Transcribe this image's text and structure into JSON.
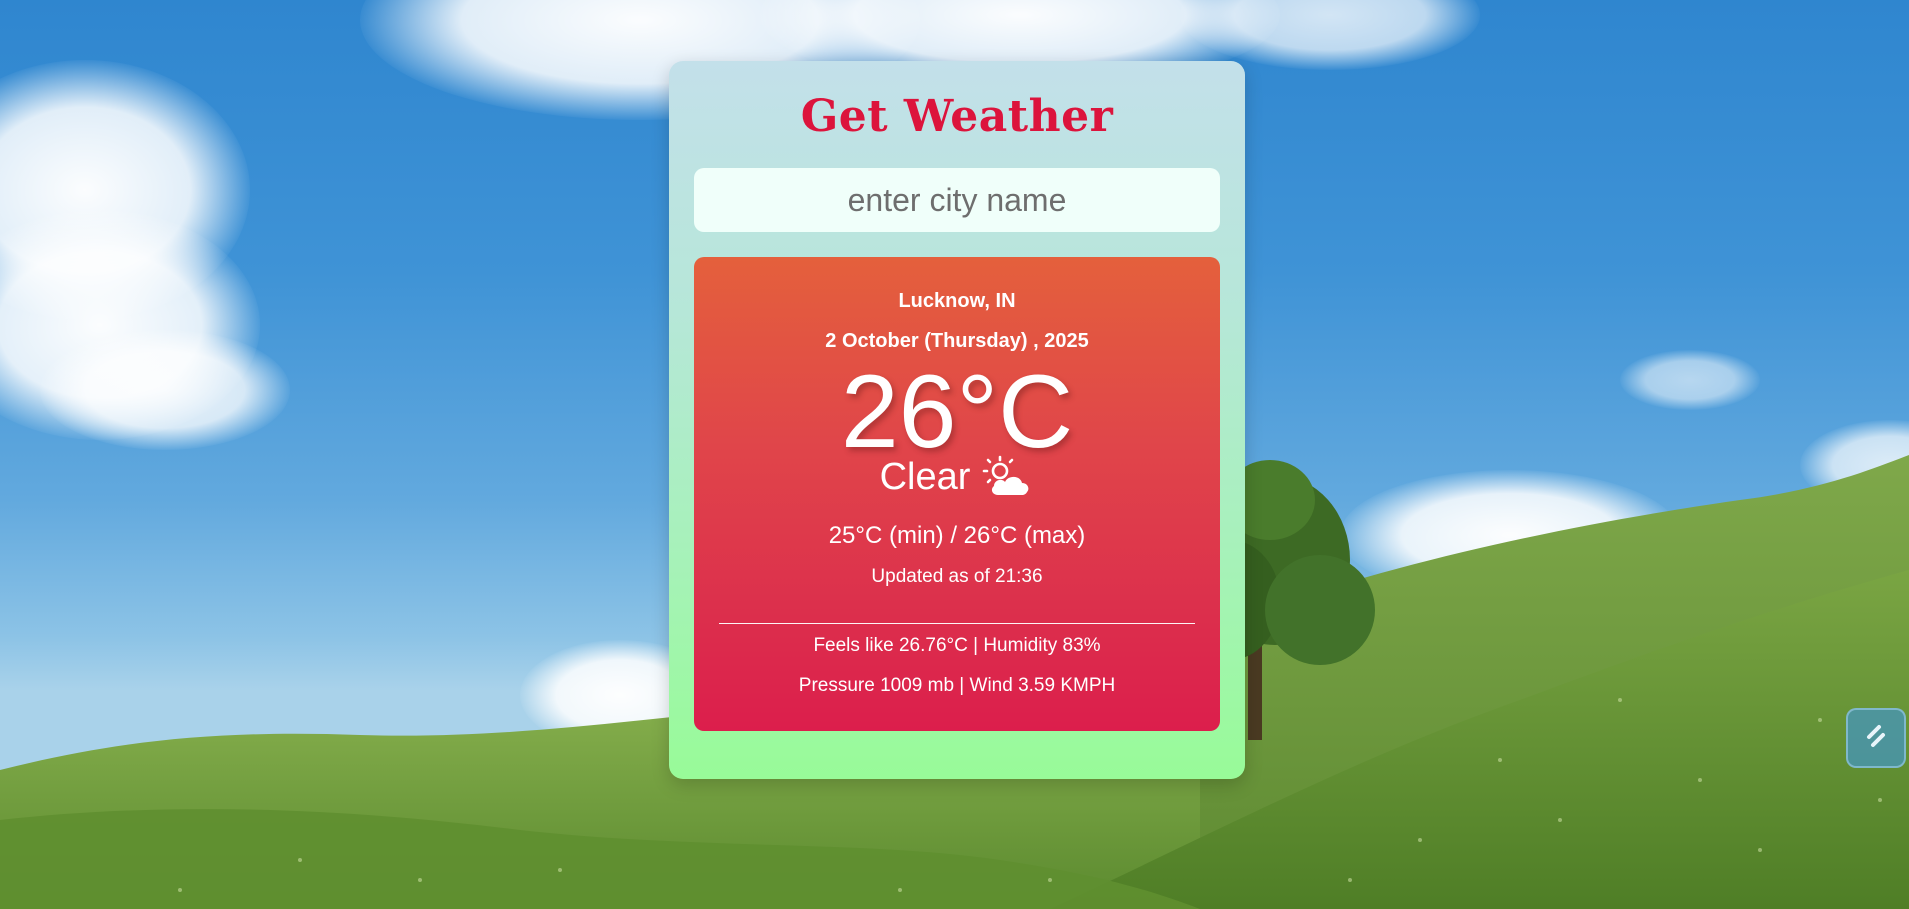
{
  "app": {
    "title": "Get Weather"
  },
  "search": {
    "placeholder": "enter city name",
    "value": ""
  },
  "weather": {
    "city": "Lucknow, IN",
    "date": "2 October (Thursday) , 2025",
    "temperature": "26°C",
    "condition": "Clear",
    "condition_icon": "sun-behind-cloud-icon",
    "range": "25°C (min) / 26°C (max)",
    "updated": "Updated as of 21:36",
    "feels_humidity": "Feels like 26.76°C | Humidity 83%",
    "pressure_wind": "Pressure 1009 mb | Wind 3.59 KMPH"
  },
  "floating_button": {
    "icon": "link-icon"
  },
  "colors": {
    "title": "#dc143c",
    "card_top": "#c3e0ea",
    "card_bottom": "#98fb98",
    "weather_top": "#e4603c",
    "weather_bottom": "#dc1e4c",
    "search_bg": "#f0fffa"
  }
}
